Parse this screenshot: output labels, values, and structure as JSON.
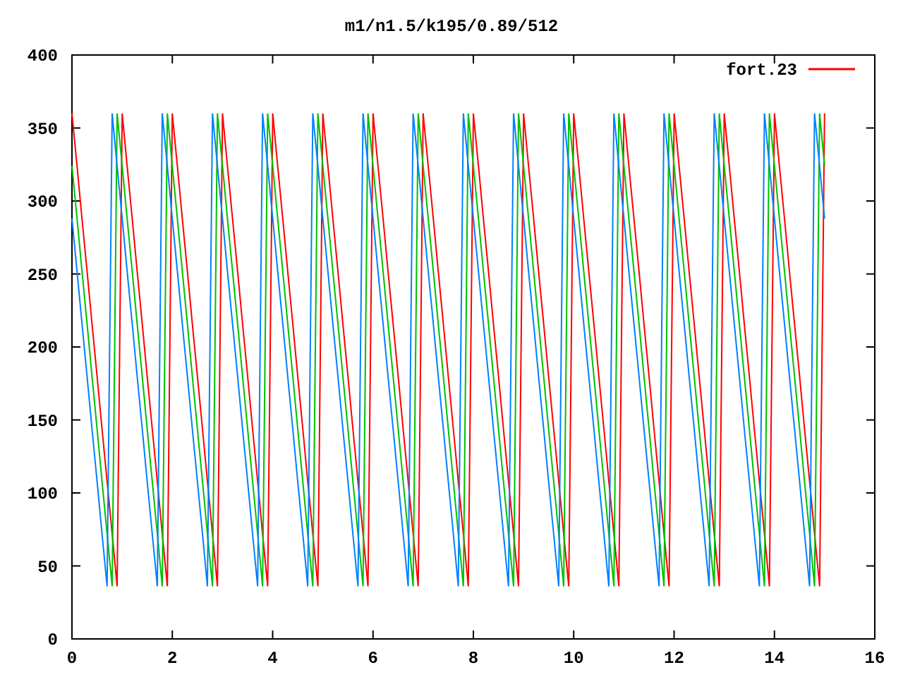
{
  "chart_data": {
    "type": "line",
    "title": "m1/n1.5/k195/0.89/512",
    "xlim": [
      0,
      16
    ],
    "ylim": [
      0,
      400
    ],
    "xticks": [
      0,
      2,
      4,
      6,
      8,
      10,
      12,
      14,
      16
    ],
    "yticks": [
      0,
      50,
      100,
      150,
      200,
      250,
      300,
      350,
      400
    ],
    "x": [
      0,
      0.1,
      0.2,
      0.3,
      0.4,
      0.5,
      0.6,
      0.7,
      0.8,
      0.9,
      1,
      1.1,
      1.2,
      1.3,
      1.4,
      1.5,
      1.6,
      1.7,
      1.8,
      1.9,
      2,
      2.1,
      2.2,
      2.3,
      2.4,
      2.5,
      2.6,
      2.7,
      2.8,
      2.9,
      3,
      3.1,
      3.2,
      3.3,
      3.4,
      3.5,
      3.6,
      3.7,
      3.8,
      3.9,
      4,
      4.1,
      4.2,
      4.3,
      4.4,
      4.5,
      4.6,
      4.7,
      4.8,
      4.9,
      5,
      5.1,
      5.2,
      5.3,
      5.4,
      5.5,
      5.6,
      5.7,
      5.8,
      5.9,
      6,
      6.1,
      6.2,
      6.3,
      6.4,
      6.5,
      6.6,
      6.7,
      6.8,
      6.9,
      7,
      7.1,
      7.2,
      7.3,
      7.4,
      7.5,
      7.6,
      7.7,
      7.8,
      7.9,
      8,
      8.1,
      8.2,
      8.3,
      8.4,
      8.5,
      8.6,
      8.7,
      8.8,
      8.9,
      9,
      9.1,
      9.2,
      9.3,
      9.4,
      9.5,
      9.6,
      9.7,
      9.8,
      9.9,
      10,
      10.1,
      10.2,
      10.3,
      10.4,
      10.5,
      10.6,
      10.7,
      10.8,
      10.9,
      11,
      11.1,
      11.2,
      11.3,
      11.4,
      11.5,
      11.6,
      11.7,
      11.8,
      11.9,
      12,
      12.1,
      12.2,
      12.3,
      12.4,
      12.5,
      12.6,
      12.7,
      12.8,
      12.9,
      13,
      13.1,
      13.2,
      13.3,
      13.4,
      13.5,
      13.6,
      13.7,
      13.8,
      13.9,
      14,
      14.1,
      14.2,
      14.3,
      14.4,
      14.5,
      14.6,
      14.7,
      14.8,
      14.9,
      15
    ],
    "series": [
      {
        "name": "fort.23",
        "color": "#ff0000",
        "values": [
          360,
          324,
          288,
          252,
          216,
          180,
          144,
          108,
          72,
          36,
          360,
          324,
          288,
          252,
          216,
          180,
          144,
          108,
          72,
          36,
          360,
          324,
          288,
          252,
          216,
          180,
          144,
          108,
          72,
          36,
          360,
          324,
          288,
          252,
          216,
          180,
          144,
          108,
          72,
          36,
          360,
          324,
          288,
          252,
          216,
          180,
          144,
          108,
          72,
          36,
          360,
          324,
          288,
          252,
          216,
          180,
          144,
          108,
          72,
          36,
          360,
          324,
          288,
          252,
          216,
          180,
          144,
          108,
          72,
          36,
          360,
          324,
          288,
          252,
          216,
          180,
          144,
          108,
          72,
          36,
          360,
          324,
          288,
          252,
          216,
          180,
          144,
          108,
          72,
          36,
          360,
          324,
          288,
          252,
          216,
          180,
          144,
          108,
          72,
          36,
          360,
          324,
          288,
          252,
          216,
          180,
          144,
          108,
          72,
          36,
          360,
          324,
          288,
          252,
          216,
          180,
          144,
          108,
          72,
          36,
          360,
          324,
          288,
          252,
          216,
          180,
          144,
          108,
          72,
          36,
          360,
          324,
          288,
          252,
          216,
          180,
          144,
          108,
          72,
          36,
          360,
          324,
          288,
          252,
          216,
          180,
          144,
          108,
          72,
          36,
          360
        ]
      },
      {
        "color": "#00c000",
        "values": [
          324,
          288,
          252,
          216,
          180,
          144,
          108,
          72,
          36,
          360,
          324,
          288,
          252,
          216,
          180,
          144,
          108,
          72,
          36,
          360,
          324,
          288,
          252,
          216,
          180,
          144,
          108,
          72,
          36,
          360,
          324,
          288,
          252,
          216,
          180,
          144,
          108,
          72,
          36,
          360,
          324,
          288,
          252,
          216,
          180,
          144,
          108,
          72,
          36,
          360,
          324,
          288,
          252,
          216,
          180,
          144,
          108,
          72,
          36,
          360,
          324,
          288,
          252,
          216,
          180,
          144,
          108,
          72,
          36,
          360,
          324,
          288,
          252,
          216,
          180,
          144,
          108,
          72,
          36,
          360,
          324,
          288,
          252,
          216,
          180,
          144,
          108,
          72,
          36,
          360,
          324,
          288,
          252,
          216,
          180,
          144,
          108,
          72,
          36,
          360,
          324,
          288,
          252,
          216,
          180,
          144,
          108,
          72,
          36,
          360,
          324,
          288,
          252,
          216,
          180,
          144,
          108,
          72,
          36,
          360,
          324,
          288,
          252,
          216,
          180,
          144,
          108,
          72,
          36,
          360,
          324,
          288,
          252,
          216,
          180,
          144,
          108,
          72,
          36,
          360,
          324,
          288,
          252,
          216,
          180,
          144,
          108,
          72,
          36,
          360,
          324
        ]
      },
      {
        "color": "#0080ff",
        "values": [
          288,
          252,
          216,
          180,
          144,
          108,
          72,
          36,
          360,
          324,
          288,
          252,
          216,
          180,
          144,
          108,
          72,
          36,
          360,
          324,
          288,
          252,
          216,
          180,
          144,
          108,
          72,
          36,
          360,
          324,
          288,
          252,
          216,
          180,
          144,
          108,
          72,
          36,
          360,
          324,
          288,
          252,
          216,
          180,
          144,
          108,
          72,
          36,
          360,
          324,
          288,
          252,
          216,
          180,
          144,
          108,
          72,
          36,
          360,
          324,
          288,
          252,
          216,
          180,
          144,
          108,
          72,
          36,
          360,
          324,
          288,
          252,
          216,
          180,
          144,
          108,
          72,
          36,
          360,
          324,
          288,
          252,
          216,
          180,
          144,
          108,
          72,
          36,
          360,
          324,
          288,
          252,
          216,
          180,
          144,
          108,
          72,
          36,
          360,
          324,
          288,
          252,
          216,
          180,
          144,
          108,
          72,
          36,
          360,
          324,
          288,
          252,
          216,
          180,
          144,
          108,
          72,
          36,
          360,
          324,
          288,
          252,
          216,
          180,
          144,
          108,
          72,
          36,
          360,
          324,
          288,
          252,
          216,
          180,
          144,
          108,
          72,
          36,
          360,
          324,
          288,
          252,
          216,
          180,
          144,
          108,
          72,
          36,
          360,
          324,
          288
        ]
      }
    ]
  }
}
